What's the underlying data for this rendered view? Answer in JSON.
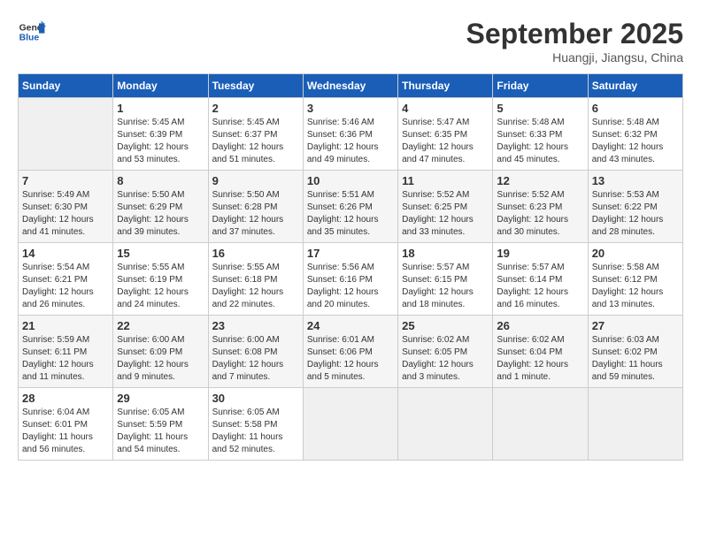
{
  "header": {
    "logo_line1": "General",
    "logo_line2": "Blue",
    "month": "September 2025",
    "location": "Huangji, Jiangsu, China"
  },
  "weekdays": [
    "Sunday",
    "Monday",
    "Tuesday",
    "Wednesday",
    "Thursday",
    "Friday",
    "Saturday"
  ],
  "weeks": [
    [
      {
        "day": "",
        "info": ""
      },
      {
        "day": "1",
        "info": "Sunrise: 5:45 AM\nSunset: 6:39 PM\nDaylight: 12 hours\nand 53 minutes."
      },
      {
        "day": "2",
        "info": "Sunrise: 5:45 AM\nSunset: 6:37 PM\nDaylight: 12 hours\nand 51 minutes."
      },
      {
        "day": "3",
        "info": "Sunrise: 5:46 AM\nSunset: 6:36 PM\nDaylight: 12 hours\nand 49 minutes."
      },
      {
        "day": "4",
        "info": "Sunrise: 5:47 AM\nSunset: 6:35 PM\nDaylight: 12 hours\nand 47 minutes."
      },
      {
        "day": "5",
        "info": "Sunrise: 5:48 AM\nSunset: 6:33 PM\nDaylight: 12 hours\nand 45 minutes."
      },
      {
        "day": "6",
        "info": "Sunrise: 5:48 AM\nSunset: 6:32 PM\nDaylight: 12 hours\nand 43 minutes."
      }
    ],
    [
      {
        "day": "7",
        "info": "Sunrise: 5:49 AM\nSunset: 6:30 PM\nDaylight: 12 hours\nand 41 minutes."
      },
      {
        "day": "8",
        "info": "Sunrise: 5:50 AM\nSunset: 6:29 PM\nDaylight: 12 hours\nand 39 minutes."
      },
      {
        "day": "9",
        "info": "Sunrise: 5:50 AM\nSunset: 6:28 PM\nDaylight: 12 hours\nand 37 minutes."
      },
      {
        "day": "10",
        "info": "Sunrise: 5:51 AM\nSunset: 6:26 PM\nDaylight: 12 hours\nand 35 minutes."
      },
      {
        "day": "11",
        "info": "Sunrise: 5:52 AM\nSunset: 6:25 PM\nDaylight: 12 hours\nand 33 minutes."
      },
      {
        "day": "12",
        "info": "Sunrise: 5:52 AM\nSunset: 6:23 PM\nDaylight: 12 hours\nand 30 minutes."
      },
      {
        "day": "13",
        "info": "Sunrise: 5:53 AM\nSunset: 6:22 PM\nDaylight: 12 hours\nand 28 minutes."
      }
    ],
    [
      {
        "day": "14",
        "info": "Sunrise: 5:54 AM\nSunset: 6:21 PM\nDaylight: 12 hours\nand 26 minutes."
      },
      {
        "day": "15",
        "info": "Sunrise: 5:55 AM\nSunset: 6:19 PM\nDaylight: 12 hours\nand 24 minutes."
      },
      {
        "day": "16",
        "info": "Sunrise: 5:55 AM\nSunset: 6:18 PM\nDaylight: 12 hours\nand 22 minutes."
      },
      {
        "day": "17",
        "info": "Sunrise: 5:56 AM\nSunset: 6:16 PM\nDaylight: 12 hours\nand 20 minutes."
      },
      {
        "day": "18",
        "info": "Sunrise: 5:57 AM\nSunset: 6:15 PM\nDaylight: 12 hours\nand 18 minutes."
      },
      {
        "day": "19",
        "info": "Sunrise: 5:57 AM\nSunset: 6:14 PM\nDaylight: 12 hours\nand 16 minutes."
      },
      {
        "day": "20",
        "info": "Sunrise: 5:58 AM\nSunset: 6:12 PM\nDaylight: 12 hours\nand 13 minutes."
      }
    ],
    [
      {
        "day": "21",
        "info": "Sunrise: 5:59 AM\nSunset: 6:11 PM\nDaylight: 12 hours\nand 11 minutes."
      },
      {
        "day": "22",
        "info": "Sunrise: 6:00 AM\nSunset: 6:09 PM\nDaylight: 12 hours\nand 9 minutes."
      },
      {
        "day": "23",
        "info": "Sunrise: 6:00 AM\nSunset: 6:08 PM\nDaylight: 12 hours\nand 7 minutes."
      },
      {
        "day": "24",
        "info": "Sunrise: 6:01 AM\nSunset: 6:06 PM\nDaylight: 12 hours\nand 5 minutes."
      },
      {
        "day": "25",
        "info": "Sunrise: 6:02 AM\nSunset: 6:05 PM\nDaylight: 12 hours\nand 3 minutes."
      },
      {
        "day": "26",
        "info": "Sunrise: 6:02 AM\nSunset: 6:04 PM\nDaylight: 12 hours\nand 1 minute."
      },
      {
        "day": "27",
        "info": "Sunrise: 6:03 AM\nSunset: 6:02 PM\nDaylight: 11 hours\nand 59 minutes."
      }
    ],
    [
      {
        "day": "28",
        "info": "Sunrise: 6:04 AM\nSunset: 6:01 PM\nDaylight: 11 hours\nand 56 minutes."
      },
      {
        "day": "29",
        "info": "Sunrise: 6:05 AM\nSunset: 5:59 PM\nDaylight: 11 hours\nand 54 minutes."
      },
      {
        "day": "30",
        "info": "Sunrise: 6:05 AM\nSunset: 5:58 PM\nDaylight: 11 hours\nand 52 minutes."
      },
      {
        "day": "",
        "info": ""
      },
      {
        "day": "",
        "info": ""
      },
      {
        "day": "",
        "info": ""
      },
      {
        "day": "",
        "info": ""
      }
    ]
  ]
}
